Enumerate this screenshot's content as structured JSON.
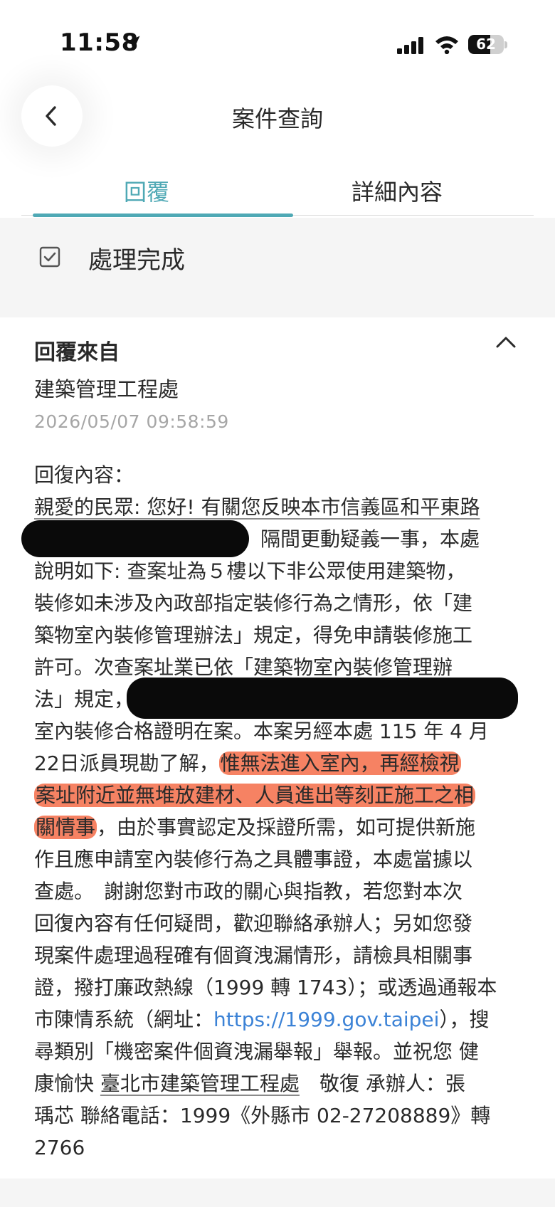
{
  "status_bar": {
    "time": "11:58",
    "battery": "62",
    "battery_level": 0.62,
    "icons": [
      "location-arrow-icon",
      "signal-icon",
      "wifi-icon",
      "battery-icon"
    ]
  },
  "header": {
    "title": "案件查詢",
    "back_icon": "chevron-left-icon"
  },
  "tabs": [
    {
      "label": "回覆",
      "active": true
    },
    {
      "label": "詳細內容",
      "active": false
    }
  ],
  "colors": {
    "accent": "#4fa9b5",
    "link": "#3b82d6",
    "highlight": "#f45f37",
    "timestamp": "#a6a6a6"
  },
  "case_status": {
    "icon": "checkbox-checked-icon",
    "label": "處理完成"
  },
  "reply": {
    "from_label": "回覆來自",
    "collapse_icon": "chevron-up-icon",
    "department": "建築管理工程處",
    "timestamp": "2026/05/07 09:58:59",
    "content_heading": "回復內容：",
    "lines": [
      "親愛的民眾: 您好! 有關您反映本市信義區和平東路",
      "隔間更動疑義一事，本處",
      "說明如下: 查案址為５樓以下非公眾使用建築物，",
      "裝修如未涉及內政部指定裝修行為之情形，依「建",
      "築物室內裝修管理辦法」規定，得免申請裝修施工",
      "許可。次查案址業已依「建築物室內裝修管理辦",
      "法」規定，",
      "室內裝修合格證明在案。本案另經本處 115 年 4 月",
      "22日派員現勘了解，",
      "惟無法進入室內，再經檢視",
      "案址附近並無堆放建材、人員進出等刻正施工之相",
      "關情事",
      "，由於事實認定及採證所需，如可提供新施",
      "作且應申請室內裝修行為之具體事證，本處當據以",
      "查處。　謝謝您對市政的關心與指教，若您對本次",
      "回復內容有任何疑問，歡迎聯絡承辦人；另如您發",
      "現案件處理過程確有個資洩漏情形，請檢具相關事",
      "證，撥打廉政熱線（1999 轉 1743）；或透過通報本",
      "市陳情系統（網址：",
      "https://1999.gov.taipei",
      "），搜",
      "尋類別「機密案件個資洩漏舉報」舉報。並祝您 健",
      "康愉快",
      "臺北市建築管理工程處",
      "　敬復 承辦人：張",
      "瑀芯 聯絡電話：1999《外縣市 02-27208889》轉",
      "2766"
    ]
  }
}
